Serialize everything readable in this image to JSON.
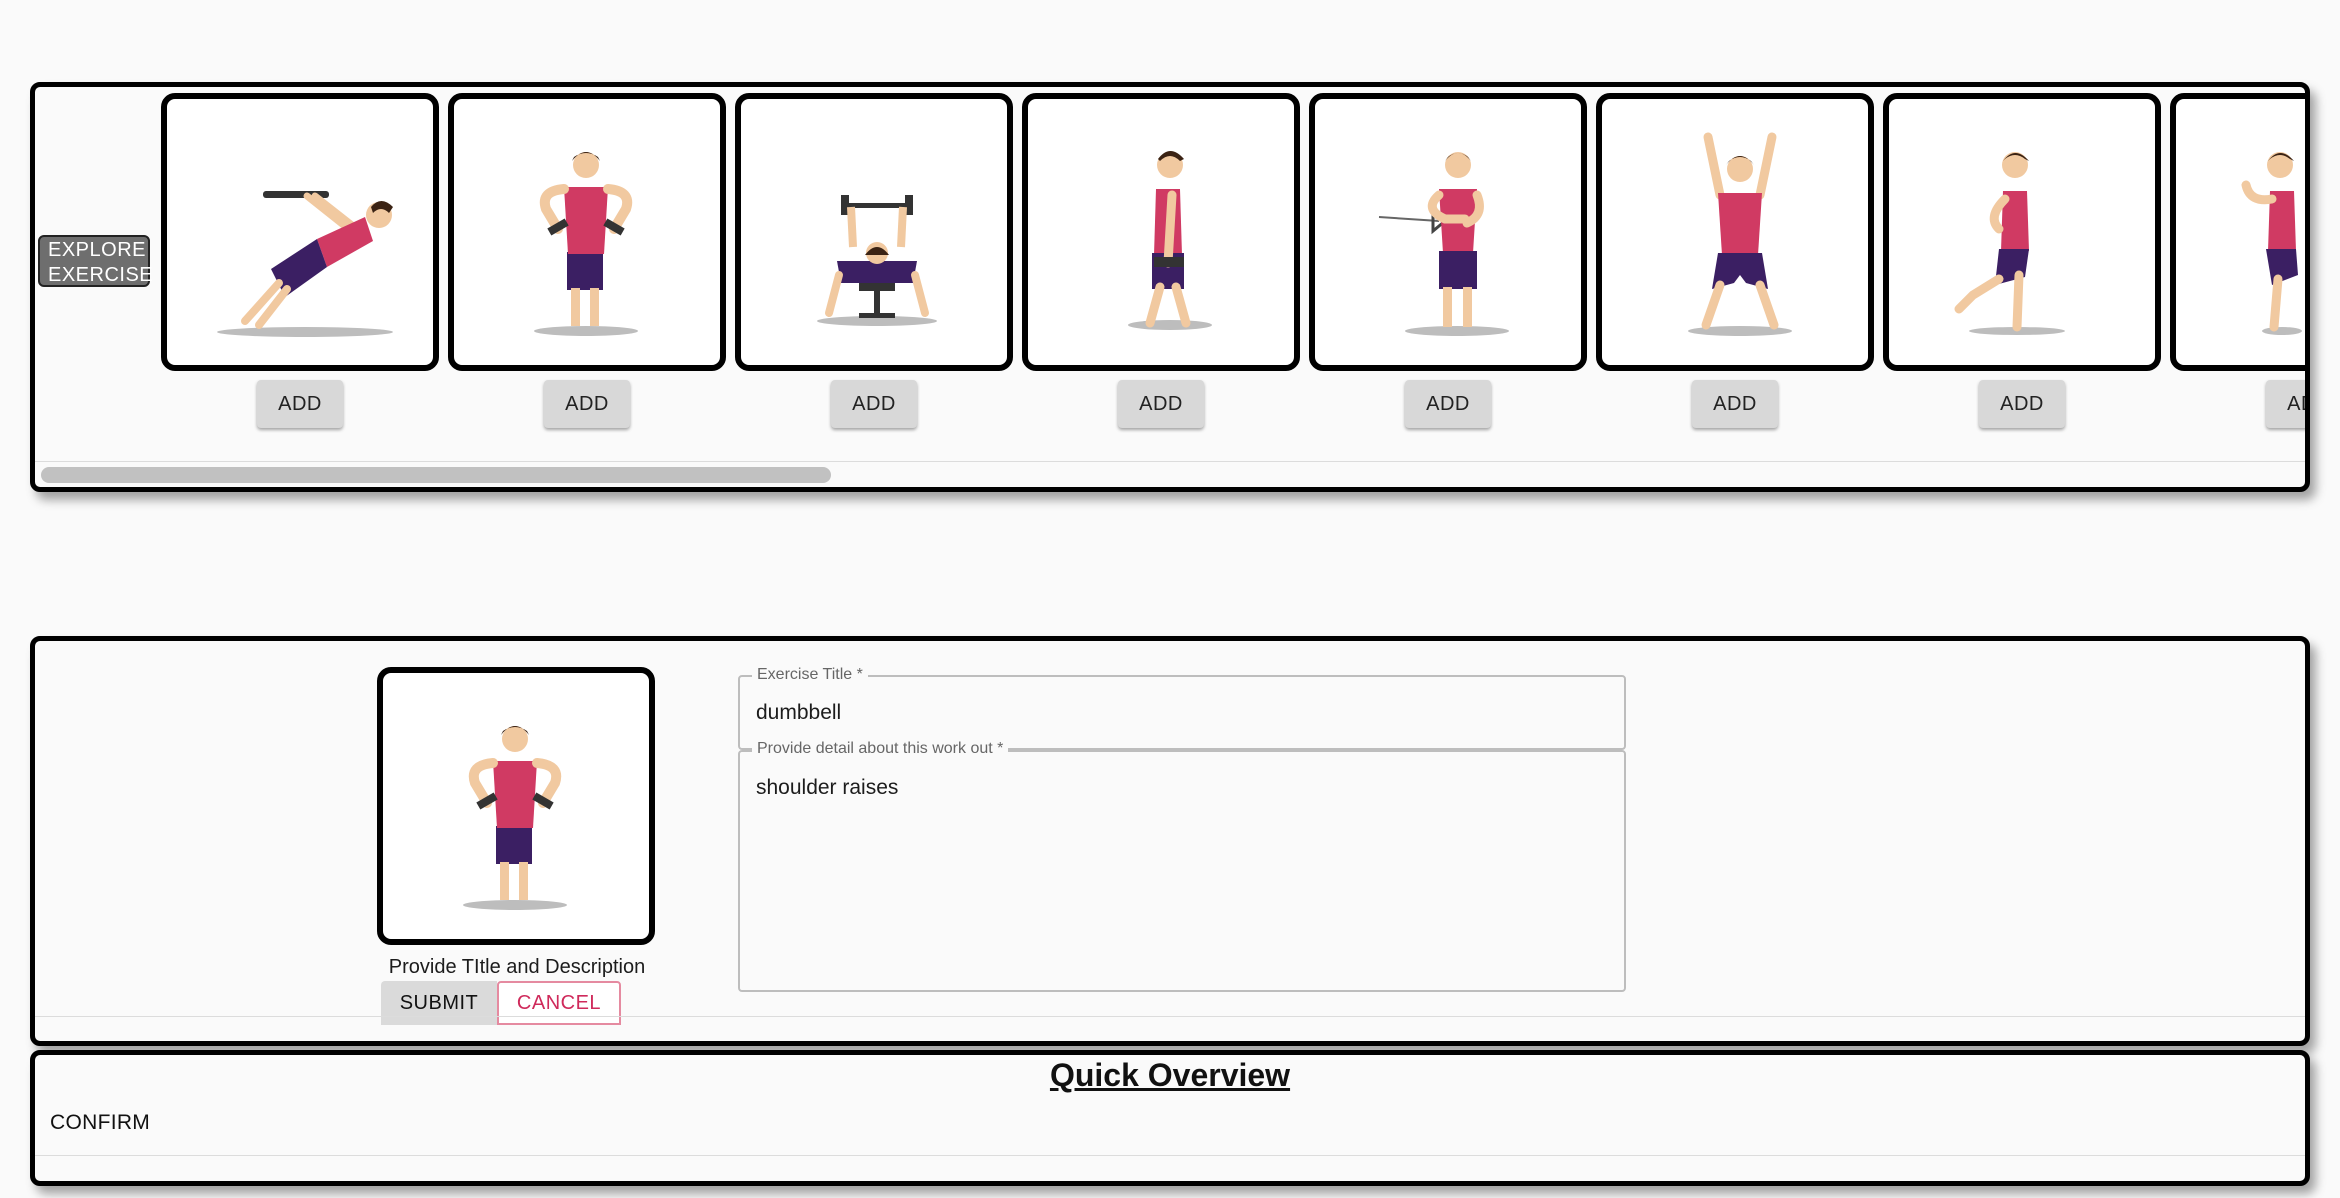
{
  "explore": {
    "label": "EXPLORE EXERCISE",
    "add_label": "ADD",
    "cards": [
      {
        "pose": "incline-row"
      },
      {
        "pose": "dumbbell-shoulder-raise"
      },
      {
        "pose": "bench-press"
      },
      {
        "pose": "dumbbell-walk"
      },
      {
        "pose": "cable-rotation"
      },
      {
        "pose": "arms-up-jack"
      },
      {
        "pose": "knee-raise"
      },
      {
        "pose": "high-knee-run"
      }
    ]
  },
  "form": {
    "prompt": "Provide TItle and Description",
    "title_label": "Exercise Title",
    "title_value": "dumbbell",
    "detail_label": "Provide detail about this work out",
    "detail_value": "shoulder raises",
    "submit_label": "SUBMIT",
    "cancel_label": "CANCEL"
  },
  "overview": {
    "title": "Quick Overview",
    "confirm_label": "CONFIRM"
  },
  "colors": {
    "shirt": "#d03a63",
    "shorts": "#3b1f63",
    "skin": "#f1c9a0",
    "hair": "#3b2314",
    "cancel": "#cf2a5b"
  }
}
